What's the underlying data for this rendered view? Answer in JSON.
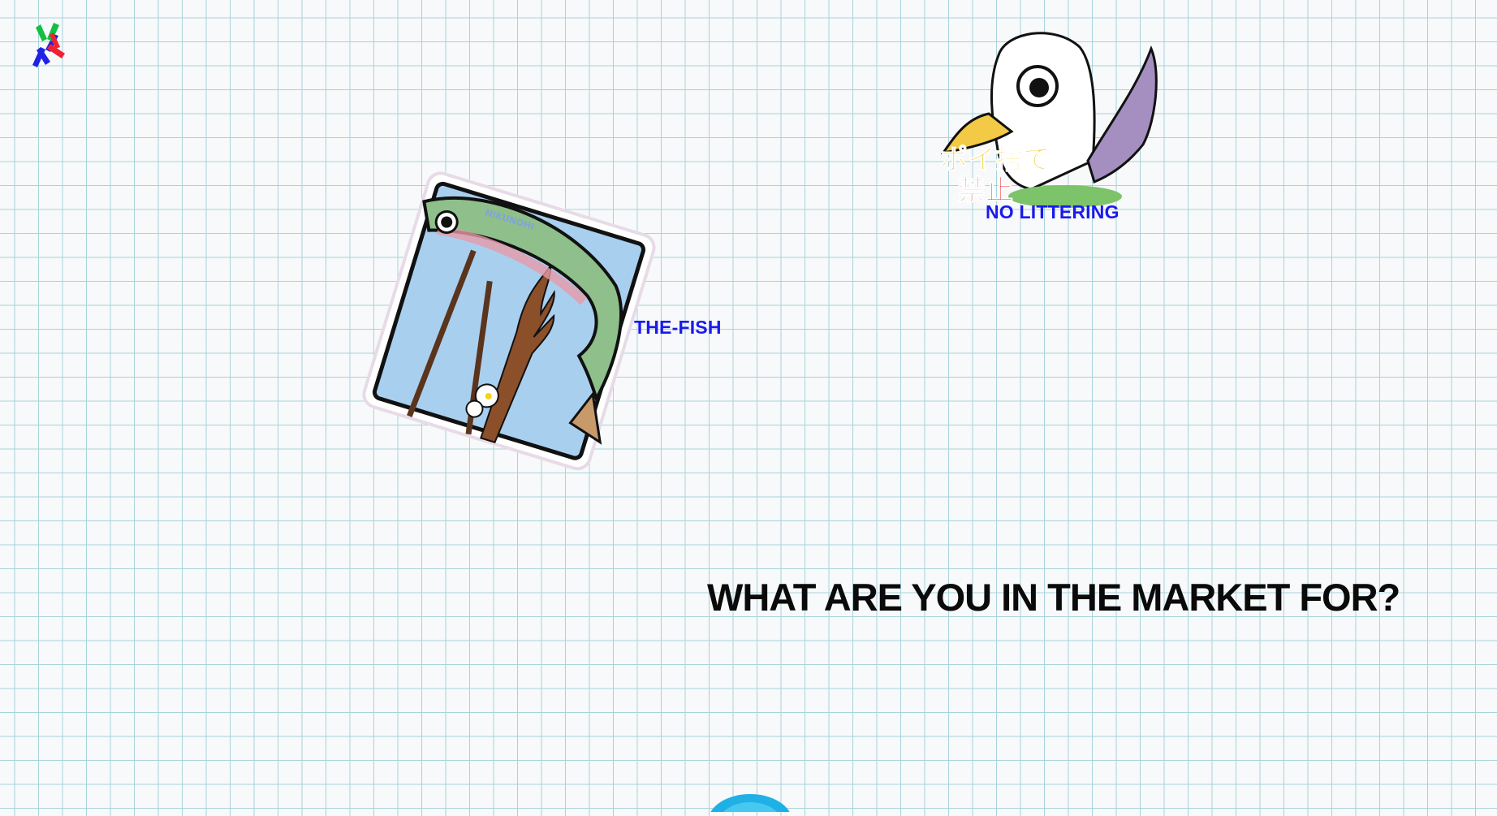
{
  "logo": {
    "icon": "nyk-logo-icon"
  },
  "stickers": [
    {
      "label": "THE-FISH",
      "icon": "fish-sticker-icon",
      "brand_mark": "NIKUNOHI"
    },
    {
      "label": "NO LITTERING",
      "icon": "seagull-sticker-icon",
      "japanese_text": "ポイ捨て禁止"
    }
  ],
  "headline": "WHAT ARE YOU IN THE MARKET FOR?",
  "colors": {
    "label_blue": "#1a1aee",
    "headline": "#0a0a0a",
    "grid": "#a9d3da",
    "sky": "#a9cfee"
  }
}
